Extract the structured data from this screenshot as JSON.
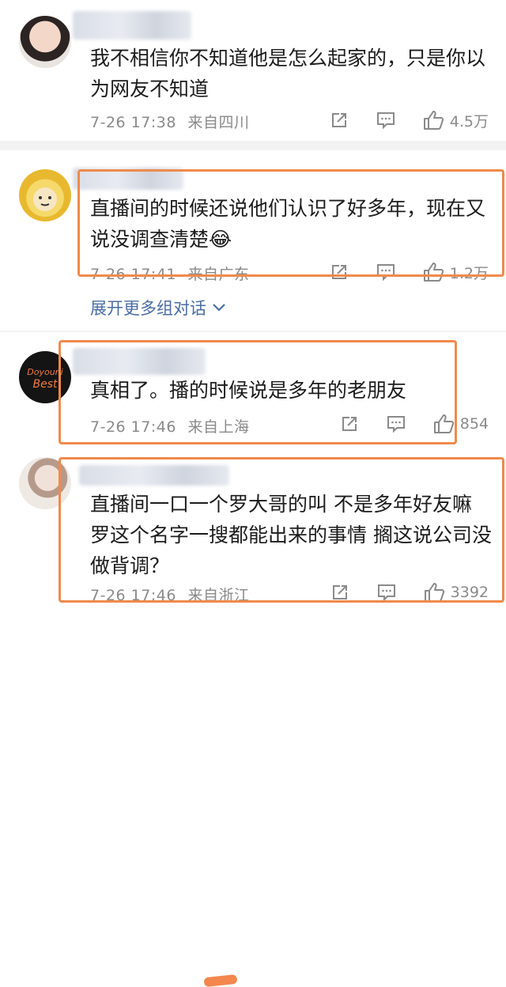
{
  "comments": [
    {
      "text": "我不相信你不知道他是怎么起家的，只是你以为网友不知道",
      "time": "7-26 17:38",
      "source": "来自四川",
      "likes": "4.5万"
    },
    {
      "text": "直播间的时候还说他们认识了好多年，现在又说没调查清楚",
      "emoji": "😂",
      "time": "7-26 17:41",
      "source": "来自广东",
      "likes": "1.2万"
    },
    {
      "text": "真相了。播的时候说是多年的老朋友",
      "time": "7-26 17:46",
      "source": "来自上海",
      "likes": "854",
      "avatar_text": "Doyouni Best"
    },
    {
      "text": "直播间一口一个罗大哥的叫 不是多年好友嘛 罗这个名字一搜都能出来的事情 搁这说公司没做背调？",
      "time": "7-26 17:46",
      "source": "来自浙江",
      "likes": "3392"
    }
  ],
  "expand_label": "展开更多组对话",
  "icons": {
    "share": "share-icon",
    "comment": "comment-icon",
    "like": "thumbs-up-icon",
    "expand": "chevron-down-icon"
  },
  "colors": {
    "highlight": "#f08a4b",
    "link": "#4a6da5",
    "meta": "#8a8a8a"
  }
}
